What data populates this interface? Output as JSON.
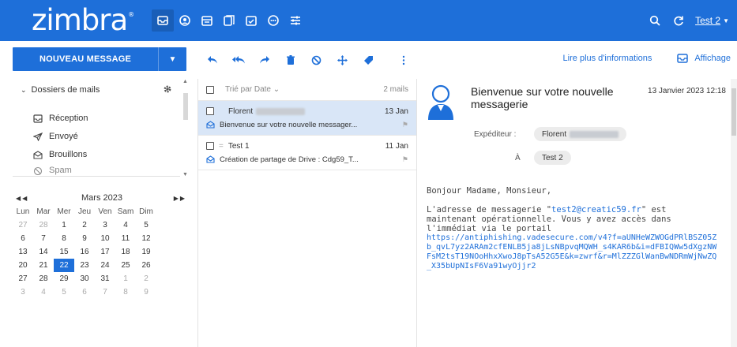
{
  "app": {
    "logo_text": "zimbra",
    "brand_color": "#1e6fd9",
    "apps": [
      {
        "icon": "mail-icon",
        "selected": true
      },
      {
        "icon": "contacts-icon",
        "selected": false
      },
      {
        "icon": "calendar-icon",
        "selected": false
      },
      {
        "icon": "tasks-icon",
        "selected": false
      },
      {
        "icon": "briefcase-icon",
        "selected": false
      },
      {
        "icon": "chat-icon",
        "selected": false
      },
      {
        "icon": "settings-sliders-icon",
        "selected": false
      }
    ],
    "user_name": "Test 2"
  },
  "toolbar": {
    "new_message_label": "NOUVEAU MESSAGE",
    "actions": [
      "reply-icon",
      "reply-all-icon",
      "forward-icon",
      "delete-icon",
      "block-icon",
      "move-icon",
      "tag-icon"
    ],
    "read_more_label": "Lire plus d'informations",
    "display_label": "Affichage"
  },
  "sidebar": {
    "folders_title": "Dossiers de mails",
    "folders": [
      {
        "label": "Réception",
        "icon": "inbox-icon"
      },
      {
        "label": "Envoyé",
        "icon": "sent-icon"
      },
      {
        "label": "Brouillons",
        "icon": "drafts-icon"
      },
      {
        "label": "Spam",
        "icon": "spam-icon"
      }
    ]
  },
  "calendar": {
    "month_label": "Mars 2023",
    "day_names": [
      "Lun",
      "Mar",
      "Mer",
      "Jeu",
      "Ven",
      "Sam",
      "Dim"
    ],
    "weeks": [
      [
        "27",
        "28",
        "1",
        "2",
        "3",
        "4",
        "5"
      ],
      [
        "6",
        "7",
        "8",
        "9",
        "10",
        "11",
        "12"
      ],
      [
        "13",
        "14",
        "15",
        "16",
        "17",
        "18",
        "19"
      ],
      [
        "20",
        "21",
        "22",
        "23",
        "24",
        "25",
        "26"
      ],
      [
        "27",
        "28",
        "29",
        "30",
        "31",
        "1",
        "2"
      ],
      [
        "3",
        "4",
        "5",
        "6",
        "7",
        "8",
        "9"
      ]
    ],
    "today": "22"
  },
  "list": {
    "sort_label": "Trié par Date",
    "count_label": "2 mails",
    "messages": [
      {
        "from": "Florent",
        "date": "13 Jan",
        "subject": "Bienvenue sur votre nouvelle messager...",
        "selected": true
      },
      {
        "from": "Test 1",
        "date": "11 Jan",
        "subject": "Création de partage de Drive : Cdg59_T...",
        "selected": false
      }
    ]
  },
  "reader": {
    "subject": "Bienvenue sur votre nouvelle messagerie",
    "date": "13 Janvier 2023 12:18",
    "from_label": "Expéditeur :",
    "from_name": "Florent",
    "to_label": "À",
    "to_name": "Test 2",
    "greeting": "Bonjour Madame, Monsieur,",
    "para_before": "L'adresse de messagerie \"",
    "email": "test2@creatic59.fr",
    "para_after": "\" est maintenant opérationnelle. Vous y avez accès dans l'immédiat via le portail",
    "link": "https://antiphishing.vadesecure.com/v4?f=aUNHeWZWOGdPRlBSZ05Zb_qvL7yz2ARAm2cfENLB5ja8jLsNBpvqMQWH_s4KAR6b&i=dFBIQWw5dXgzNWFsM2tsT19NOoHhxXwoJ8pTsA52G5E&k=zwrf&r=MlZZZGlWanBwNDRmWjNwZQ_X35bUpNIsF6Va91wyOjjr2"
  }
}
